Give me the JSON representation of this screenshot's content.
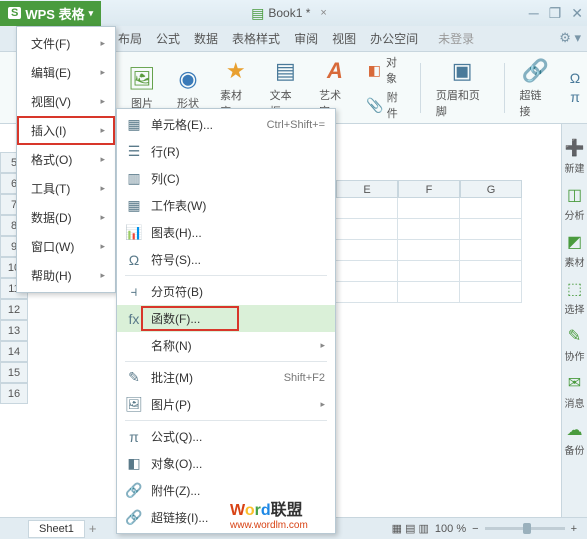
{
  "app": {
    "badge_letter": "S",
    "name": "WPS 表格",
    "dropdown_arrow": "▾"
  },
  "document": {
    "name": "Book1 *",
    "close": "×"
  },
  "window_controls": {
    "min": "─",
    "restore": "❐",
    "close": "✕"
  },
  "menubar": {
    "items": [
      "布局",
      "公式",
      "数据",
      "表格样式",
      "审阅",
      "视图",
      "办公空间"
    ],
    "nologin": "未登录"
  },
  "ribbon": {
    "image": "图片",
    "shapes": "形状",
    "gallery": "素材库",
    "textbox": "文本框",
    "wordart": "艺术字",
    "object": "对象",
    "attachment": "附件",
    "headerfooter": "页眉和页脚",
    "hyperlink": "超链接",
    "extra1": "Ω",
    "extra2": "π"
  },
  "file_menu": {
    "items": [
      {
        "label": "文件(F)",
        "arrow": true
      },
      {
        "label": "编辑(E)",
        "arrow": true
      },
      {
        "label": "视图(V)",
        "arrow": true
      },
      {
        "label": "插入(I)",
        "arrow": true,
        "highlight": true
      },
      {
        "label": "格式(O)",
        "arrow": true
      },
      {
        "label": "工具(T)",
        "arrow": true
      },
      {
        "label": "数据(D)",
        "arrow": true
      },
      {
        "label": "窗口(W)",
        "arrow": true
      },
      {
        "label": "帮助(H)",
        "arrow": true
      }
    ]
  },
  "insert_menu": {
    "items": [
      {
        "icon": "▦",
        "label": "单元格(E)...",
        "shortcut": "Ctrl+Shift+="
      },
      {
        "icon": "☰",
        "label": "行(R)"
      },
      {
        "icon": "▥",
        "label": "列(C)"
      },
      {
        "icon": "▦",
        "label": "工作表(W)"
      },
      {
        "icon": "📊",
        "label": "图表(H)..."
      },
      {
        "icon": "Ω",
        "label": "符号(S)...",
        "sep_after": true
      },
      {
        "icon": "⫞",
        "label": "分页符(B)"
      },
      {
        "icon": "fx",
        "label": "函数(F)...",
        "highlight": true,
        "hover": true
      },
      {
        "icon": "",
        "label": "名称(N)",
        "arrow": true,
        "sep_after": true
      },
      {
        "icon": "✎",
        "label": "批注(M)",
        "shortcut": "Shift+F2"
      },
      {
        "icon": "🖼",
        "label": "图片(P)",
        "arrow": true,
        "sep_after": true
      },
      {
        "icon": "π",
        "label": "公式(Q)..."
      },
      {
        "icon": "◧",
        "label": "对象(O)..."
      },
      {
        "icon": "🔗",
        "label": "附件(Z)..."
      },
      {
        "icon": "🔗",
        "label": "超链接(I)..."
      }
    ]
  },
  "columns": [
    "E",
    "F",
    "G"
  ],
  "rows": [
    "5",
    "6",
    "7",
    "8",
    "9",
    "10",
    "11",
    "12",
    "13",
    "14",
    "15",
    "16"
  ],
  "right_sidebar": {
    "items": [
      {
        "icon": "➕",
        "label": "新建"
      },
      {
        "icon": "◫",
        "label": "分析"
      },
      {
        "icon": "◩",
        "label": "素材"
      },
      {
        "icon": "⬚",
        "label": "选择"
      },
      {
        "icon": "✎",
        "label": "协作"
      },
      {
        "icon": "✉",
        "label": "消息"
      },
      {
        "icon": "☁",
        "label": "备份"
      }
    ]
  },
  "statusbar": {
    "sheet": "Sheet1",
    "add": "+",
    "zoom_icons": "▦ ▤ ▥",
    "zoom": "100 %"
  },
  "watermark": {
    "w": "W",
    "o": "o",
    "r": "r",
    "d": "d",
    "rest": "联盟",
    "url": "www.wordlm.com"
  }
}
